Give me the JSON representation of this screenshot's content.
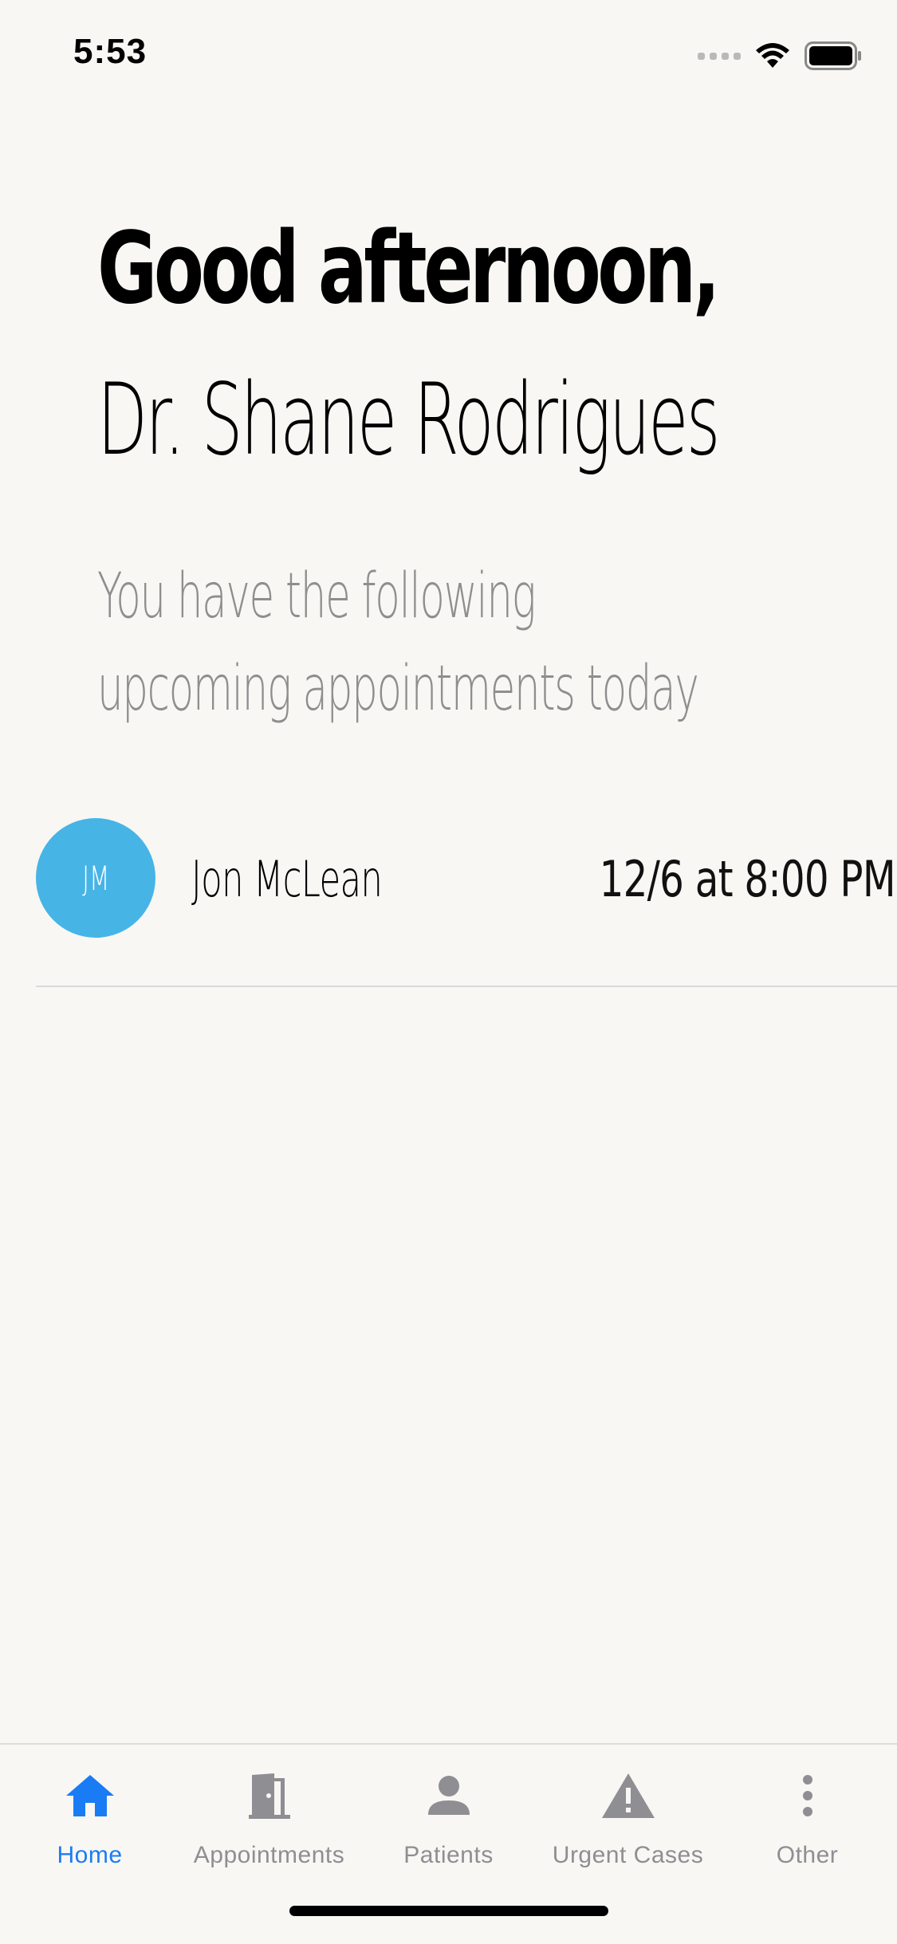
{
  "status_bar": {
    "time": "5:53"
  },
  "greeting": {
    "line1": "Good afternoon,",
    "line2": "Dr. Shane Rodrigues"
  },
  "subtitle": "You have the following upcoming appointments today",
  "appointments": [
    {
      "initials": "JM",
      "patient": "Jon McLean",
      "time": "12/6 at 8:00 PM",
      "avatar_color": "#47b4e6"
    }
  ],
  "tabs": [
    {
      "label": "Home",
      "icon": "home-icon",
      "active": true
    },
    {
      "label": "Appointments",
      "icon": "door-icon",
      "active": false
    },
    {
      "label": "Patients",
      "icon": "person-icon",
      "active": false
    },
    {
      "label": "Urgent Cases",
      "icon": "warning-icon",
      "active": false
    },
    {
      "label": "Other",
      "icon": "more-vertical-icon",
      "active": false
    }
  ],
  "colors": {
    "background": "#f8f7f4",
    "accent": "#1a7cf4",
    "inactive": "#8e8e93"
  }
}
